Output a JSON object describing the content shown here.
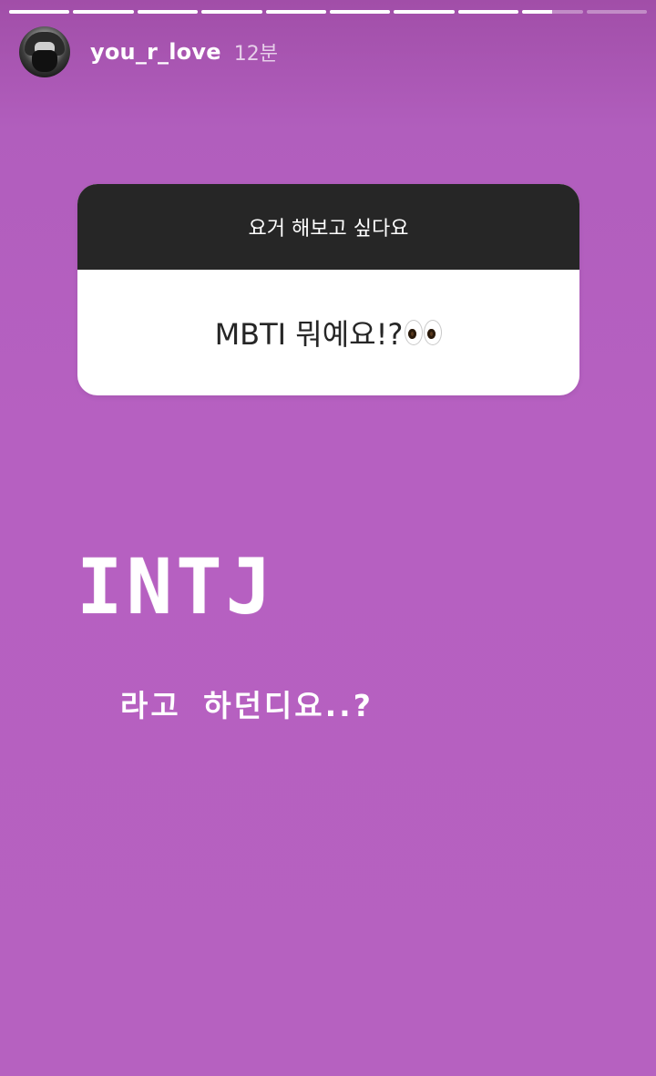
{
  "progress": {
    "segments": [
      1,
      1,
      1,
      1,
      1,
      1,
      1,
      1,
      0.5,
      0
    ]
  },
  "header": {
    "username": "you_r_love",
    "timestamp": "12분"
  },
  "question_sticker": {
    "prompt": "요거 해보고 싶다요",
    "answer": "MBTI 뭐예요!?",
    "answer_emoji": "eyes-icon"
  },
  "story": {
    "main_text": "INTJ",
    "sub_text": "라고 하던디요..?"
  },
  "colors": {
    "background": "#b660c1",
    "card_header": "#262626",
    "card_body": "#ffffff"
  }
}
